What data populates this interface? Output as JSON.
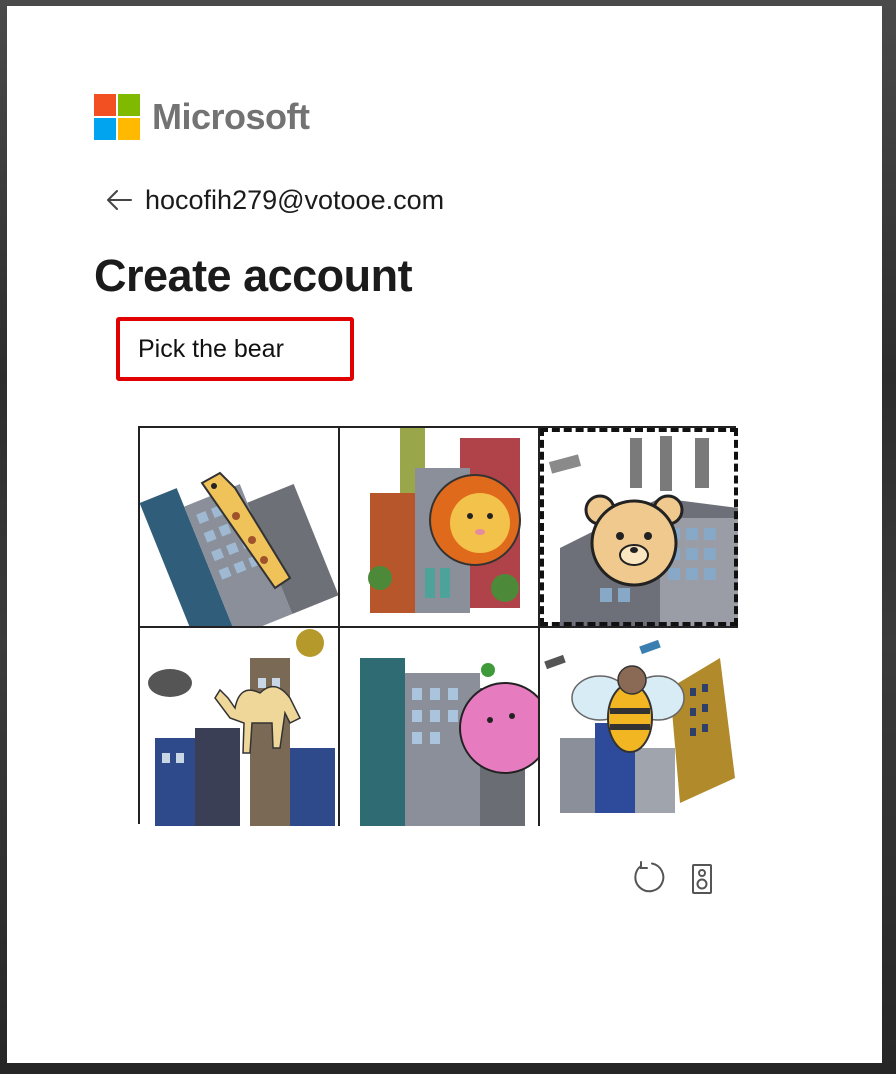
{
  "brand": {
    "name": "Microsoft",
    "logo_colors": [
      "#f25022",
      "#7fba00",
      "#00a4ef",
      "#ffb900"
    ]
  },
  "identity": {
    "back_icon": "arrow-left-icon",
    "email": "hocofih279@votooe.com"
  },
  "page": {
    "title": "Create account"
  },
  "challenge": {
    "instruction": "Pick the bear",
    "highlight_color": "#e00000",
    "tiles": [
      {
        "animal": "giraffe",
        "selected": false
      },
      {
        "animal": "lion",
        "selected": false
      },
      {
        "animal": "bear",
        "selected": true
      },
      {
        "animal": "camel",
        "selected": false
      },
      {
        "animal": "pink-ball",
        "selected": false
      },
      {
        "animal": "bee",
        "selected": false
      }
    ]
  },
  "tools": {
    "refresh_icon": "refresh-icon",
    "audio_icon": "speaker-icon"
  }
}
